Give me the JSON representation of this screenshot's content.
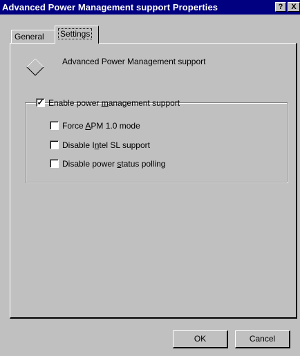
{
  "window": {
    "title": "Advanced Power Management support Properties",
    "help_glyph": "?",
    "close_glyph": "X"
  },
  "tabs": [
    {
      "label": "General",
      "active": false
    },
    {
      "label": "Settings",
      "active": true
    }
  ],
  "settings": {
    "heading": "Advanced Power Management support",
    "icon": "diamond-icon",
    "enable_pm": {
      "pre": "Enable power ",
      "ul": "m",
      "post": "anagement support",
      "checked": true,
      "check_glyph": "✓"
    },
    "options": [
      {
        "pre": "Force ",
        "ul": "A",
        "post": "PM 1.0 mode",
        "checked": false
      },
      {
        "pre": "Disable I",
        "ul": "n",
        "post": "tel SL support",
        "checked": false
      },
      {
        "pre": "Disable power ",
        "ul": "s",
        "post": "tatus polling",
        "checked": false
      }
    ]
  },
  "buttons": {
    "ok": "OK",
    "cancel": "Cancel"
  }
}
